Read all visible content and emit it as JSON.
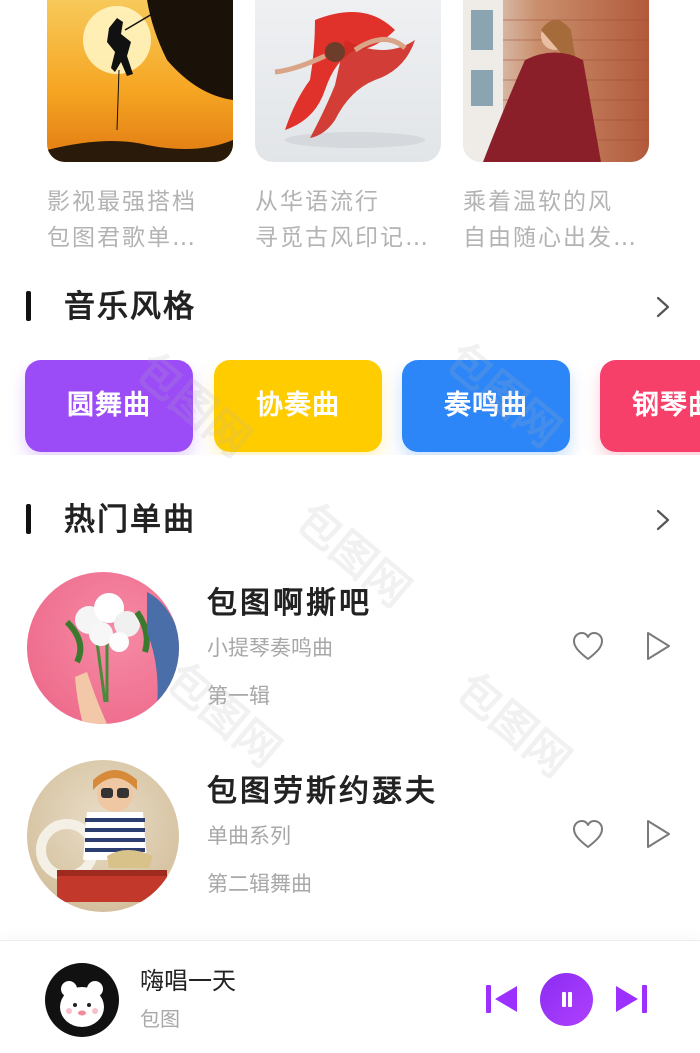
{
  "playlists": [
    {
      "line1": "影视最强搭档",
      "line2": "包图君歌单…",
      "cover_icon": "rock-climber-sunset-image"
    },
    {
      "line1": "从华语流行",
      "line2": "寻觅古风印记…",
      "cover_icon": "dancer-red-dress-image"
    },
    {
      "line1": "乘着温软的风",
      "line2": "自由随心出发…",
      "cover_icon": "woman-red-coat-image"
    }
  ],
  "styles_section": {
    "title": "音乐风格",
    "more_icon": "chevron-right-icon"
  },
  "genres": [
    {
      "label": "圆舞曲",
      "color": "#9b4cf7"
    },
    {
      "label": "协奏曲",
      "color": "#ffcc00"
    },
    {
      "label": "奏鸣曲",
      "color": "#2d86f7"
    },
    {
      "label": "钢琴曲",
      "color": "#f6406a"
    }
  ],
  "hot_section": {
    "title": "热门单曲",
    "more_icon": "chevron-right-icon"
  },
  "songs": [
    {
      "title": "包图啊撕吧",
      "subtitle": "小提琴奏鸣曲",
      "album": "第一辑",
      "cover_icon": "flower-bouquet-image"
    },
    {
      "title": "包图劳斯约瑟夫",
      "subtitle": "单曲系列",
      "album": "第二辑舞曲",
      "cover_icon": "child-binoculars-image"
    }
  ],
  "player": {
    "title": "嗨唱一天",
    "artist": "包图",
    "accent": "#9b30ff"
  },
  "watermark": "包图网"
}
